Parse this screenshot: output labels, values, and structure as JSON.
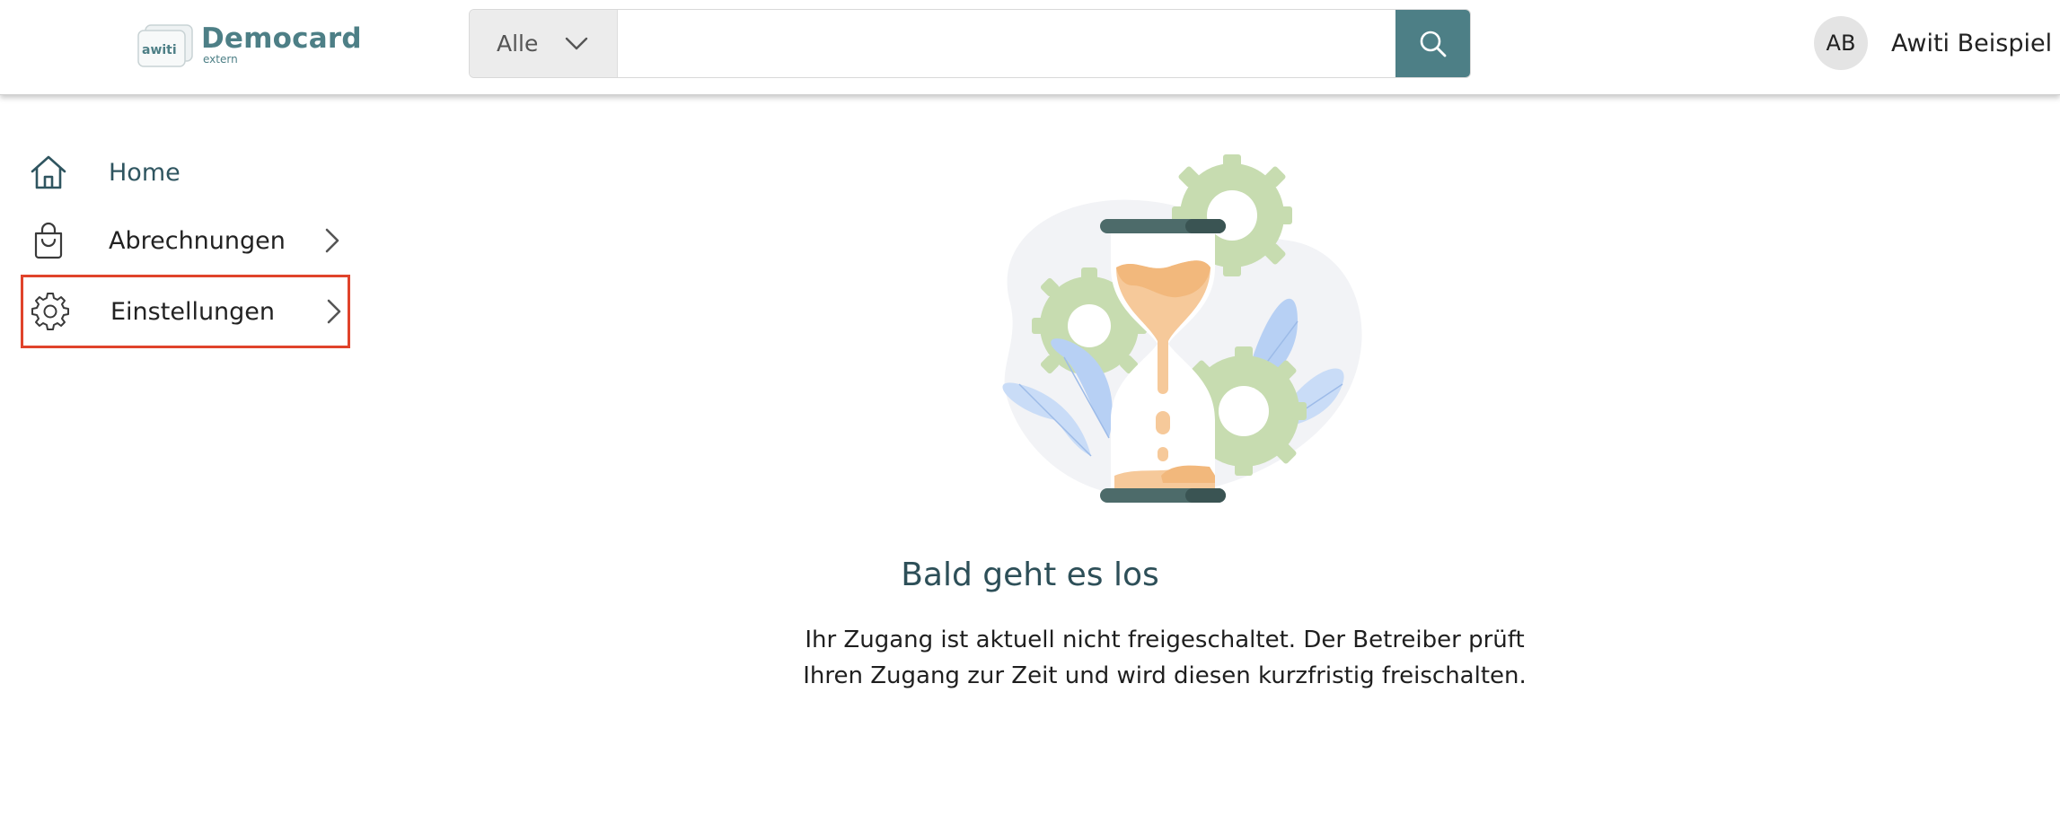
{
  "header": {
    "logo_mark_text": "awiti",
    "logo_title": "Democard",
    "logo_subtitle": "extern",
    "search": {
      "category": "Alle",
      "placeholder": "",
      "value": ""
    },
    "user": {
      "initials": "AB",
      "name": "Awiti Beispiel"
    }
  },
  "sidebar": {
    "items": [
      {
        "label": "Home",
        "icon": "home-icon",
        "has_chevron": false
      },
      {
        "label": "Abrechnungen",
        "icon": "shopping-bag-icon",
        "has_chevron": true
      },
      {
        "label": "Einstellungen",
        "icon": "gear-icon",
        "has_chevron": true,
        "highlighted": true
      }
    ]
  },
  "main": {
    "title": "Bald geht es los",
    "message_line1": "Ihr Zugang ist aktuell nicht freigeschaltet. Der Betreiber prüft",
    "message_line2": "Ihren Zugang zur Zeit und wird diesen kurzfristig freischalten."
  },
  "colors": {
    "brand": "#4d7f86",
    "highlight_border": "#e0432b",
    "title_text": "#2d4f58"
  }
}
